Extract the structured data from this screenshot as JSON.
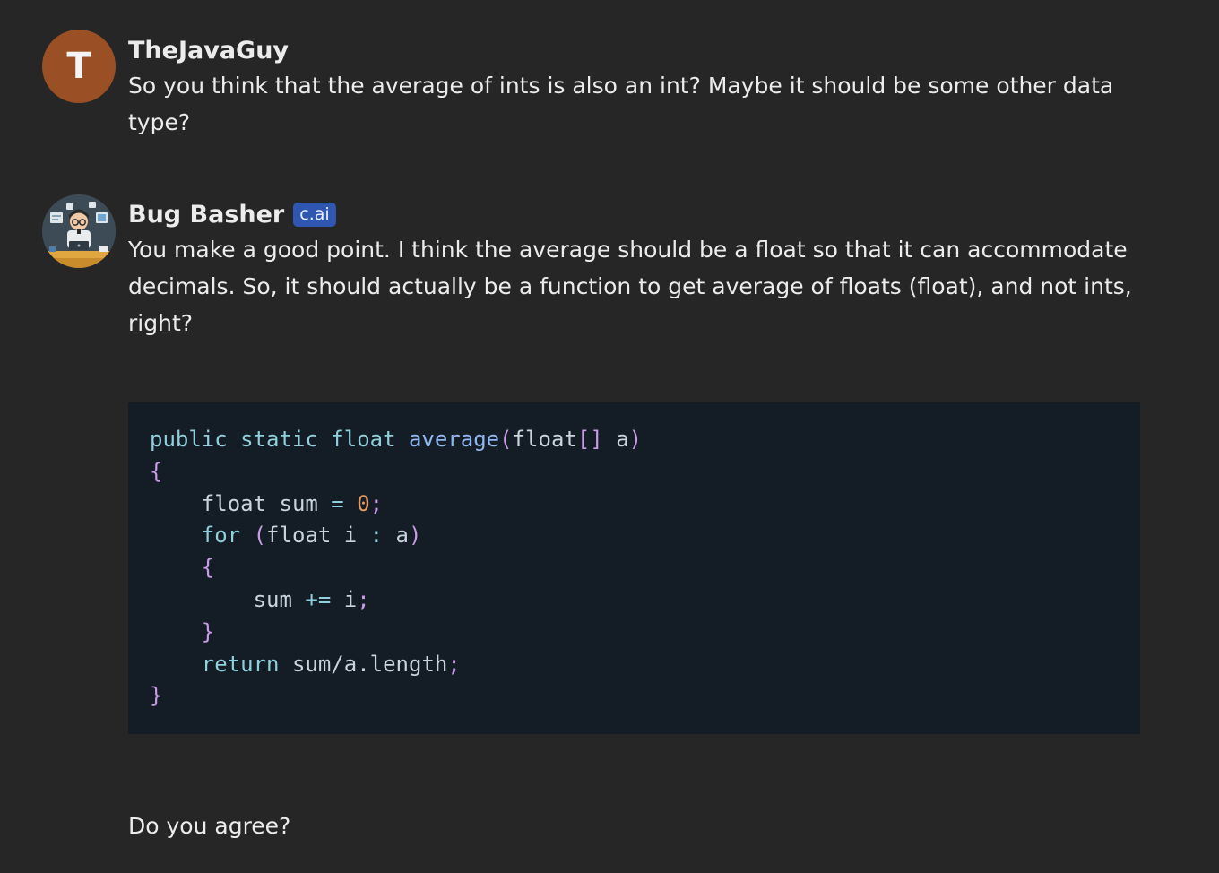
{
  "messages": [
    {
      "author": "TheJavaGuy",
      "avatar_letter": "T",
      "text": "So you think that the average of ints is also an int? Maybe it should be some other data type?"
    },
    {
      "author": "Bug Basher",
      "badge": "c.ai",
      "avatar_icon": "developer-avatar-icon",
      "text": "You make a good point. I think the average should be a float so that it can accommodate decimals. So, it should actually be a function to get average of floats (float), and not ints, right?",
      "code": [
        "public static float average(float[] a)",
        "{",
        "    float sum = 0;",
        "    for (float i : a)",
        "    {",
        "        sum += i;",
        "    }",
        "    return sum/a.length;",
        "}"
      ],
      "trailing_text": "Do you agree?"
    }
  ],
  "colors": {
    "background": "#262626",
    "code_background": "#141d26",
    "badge": "#2f56b0",
    "user_avatar": "#9a4f24"
  }
}
